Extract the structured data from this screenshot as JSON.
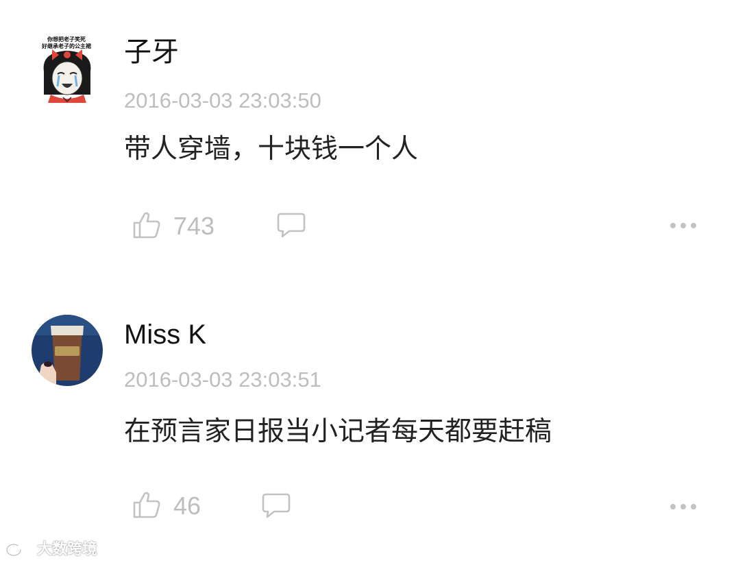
{
  "comments": [
    {
      "username": "子牙",
      "timestamp": "2016-03-03 23:03:50",
      "content": "带人穿墙，十块钱一个人",
      "likes": "743",
      "avatar": {
        "meme_line1": "你想把老子笑死",
        "meme_line2": "好继承老子的公主裙"
      }
    },
    {
      "username": "Miss K",
      "timestamp": "2016-03-03 23:03:51",
      "content": "在预言家日报当小记者每天都要赶稿",
      "likes": "46"
    }
  ],
  "watermark": {
    "text": "大数跨境"
  },
  "colors": {
    "muted": "#bdbdbd",
    "text": "#222222",
    "username": "#111111"
  }
}
